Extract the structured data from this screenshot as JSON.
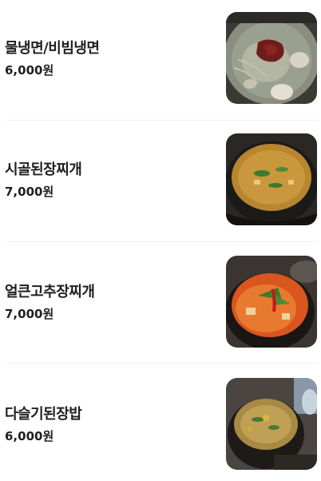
{
  "menu": {
    "items": [
      {
        "name": "물냉면/비빔냉면",
        "price": "6,000원",
        "photo": "naengmyeon-photo"
      },
      {
        "name": "시골된장찌개",
        "price": "7,000원",
        "photo": "doenjang-jjigae-photo"
      },
      {
        "name": "얼큰고추장찌개",
        "price": "7,000원",
        "photo": "gochujang-jjigae-photo"
      },
      {
        "name": "다슬기된장밥",
        "price": "6,000원",
        "photo": "daseulgi-doenjang-bap-photo"
      }
    ]
  }
}
